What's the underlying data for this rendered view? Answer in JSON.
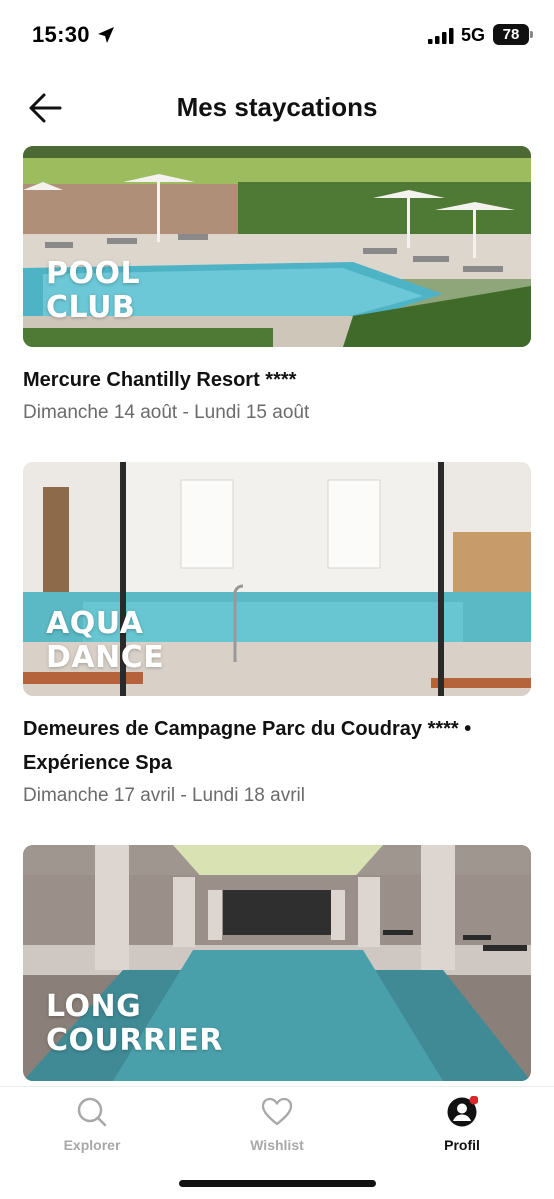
{
  "status_bar": {
    "time": "15:30",
    "network": "5G",
    "battery": "78"
  },
  "header": {
    "title": "Mes staycations",
    "back_icon": "arrow-left-icon"
  },
  "staycations": [
    {
      "badge_line1": "POOL",
      "badge_line2": "CLUB",
      "name": "Mercure Chantilly Resort ****",
      "dates": "Dimanche 14 août - Lundi 15 août"
    },
    {
      "badge_line1": "AQUA",
      "badge_line2": "DANCE",
      "name_line1": "Demeures de Campagne Parc du Coudray **** •",
      "name_line2": "Expérience Spa",
      "dates": "Dimanche 17 avril - Lundi 18 avril"
    },
    {
      "badge_line1": "LONG",
      "badge_line2": "COURRIER"
    }
  ],
  "tabbar": {
    "tabs": [
      {
        "label": "Explorer",
        "icon": "search-icon",
        "active": false
      },
      {
        "label": "Wishlist",
        "icon": "heart-icon",
        "active": false
      },
      {
        "label": "Profil",
        "icon": "profile-icon",
        "active": true
      }
    ],
    "notification_color": "#e0262c"
  }
}
